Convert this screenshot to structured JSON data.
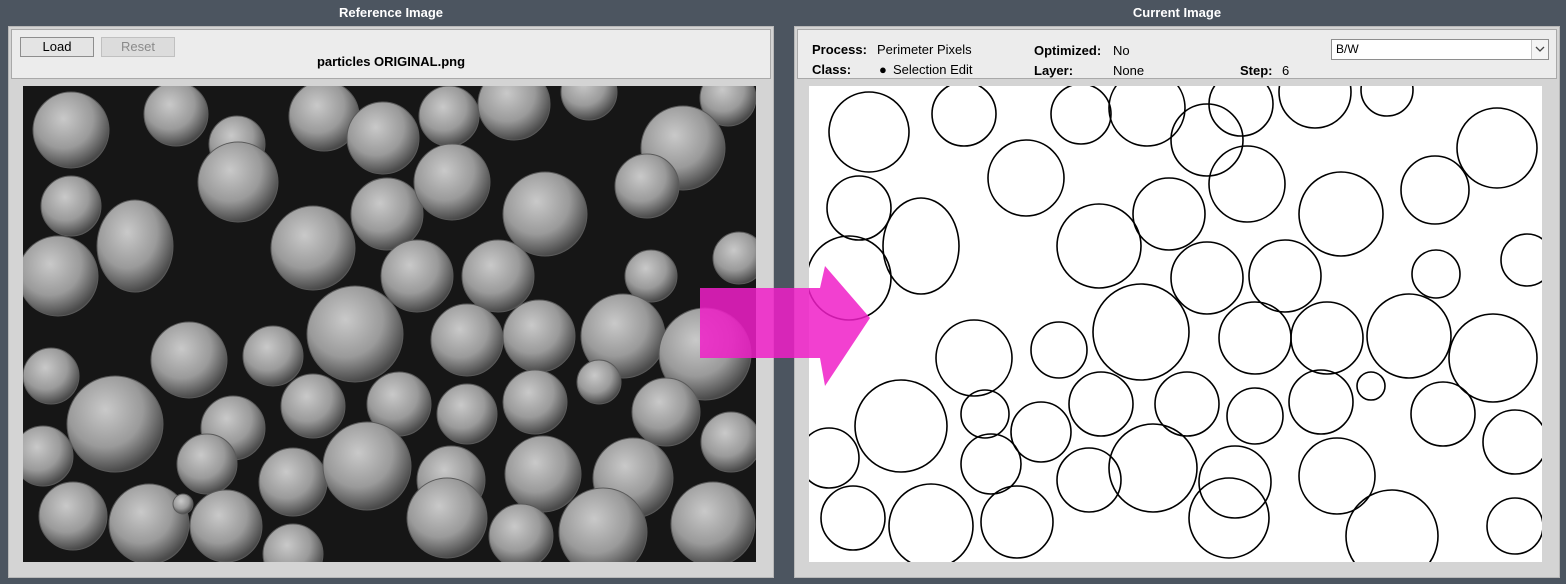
{
  "reference": {
    "title": "Reference Image",
    "load_label": "Load",
    "reset_label": "Reset",
    "filename": "particles ORIGINAL.png"
  },
  "current": {
    "title": "Current Image",
    "process_label": "Process:",
    "process_value": "Perimeter Pixels",
    "class_label": "Class:",
    "class_value": "Selection Edit",
    "optimized_label": "Optimized:",
    "optimized_value": "No",
    "layer_label": "Layer:",
    "layer_value": "None",
    "step_label": "Step:",
    "step_value": "6",
    "view_mode": "B/W"
  },
  "icons": {
    "class_bullet": "bullet-icon",
    "dropdown": "chevron-down-icon",
    "flow": "right-arrow-icon"
  },
  "colors": {
    "background": "#4c5560",
    "arrow": "#f01ec8"
  }
}
